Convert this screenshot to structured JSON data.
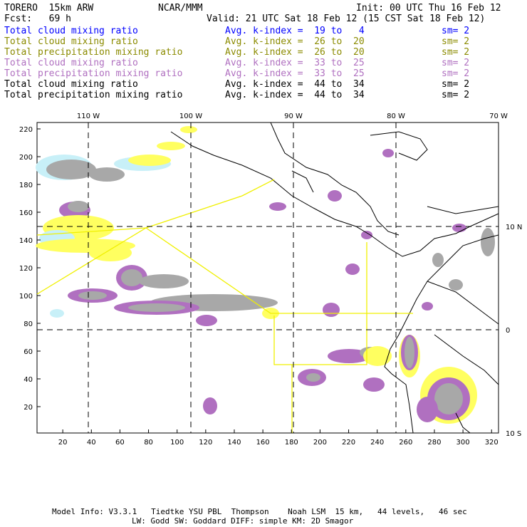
{
  "header": {
    "model": "TORERO  15km ARW",
    "org": "NCAR/MMM",
    "init": "Init: 00 UTC Thu 16 Feb 12",
    "fcst": "Fcst:   69 h",
    "valid": "Valid: 21 UTC Sat 18 Feb 12 (15 CST Sat 18 Feb 12)"
  },
  "legend": [
    {
      "field": "Total cloud mixing ratio",
      "range": "Avg. k-index =  19 to   4",
      "sm": "sm= 2",
      "color": "#0000ff"
    },
    {
      "field": "Total cloud mixing ratio",
      "range": "Avg. k-index =  26 to  20",
      "sm": "sm= 2",
      "color": "#8b8b00"
    },
    {
      "field": "Total precipitation mixing ratio",
      "range": "Avg. k-index =  26 to  20",
      "sm": "sm= 2",
      "color": "#8b8b00"
    },
    {
      "field": "Total cloud mixing ratio",
      "range": "Avg. k-index =  33 to  25",
      "sm": "sm= 2",
      "color": "#b070c0"
    },
    {
      "field": "Total precipitation mixing ratio",
      "range": "Avg. k-index =  33 to  25",
      "sm": "sm= 2",
      "color": "#b070c0"
    },
    {
      "field": "Total cloud mixing ratio",
      "range": "Avg. k-index =  44 to  34",
      "sm": "sm= 2",
      "color": "#000000"
    },
    {
      "field": "Total precipitation mixing ratio",
      "range": "Avg. k-index =  44 to  34",
      "sm": "sm= 2",
      "color": "#000000"
    }
  ],
  "map": {
    "x_ticks": [
      "20",
      "40",
      "60",
      "80",
      "100",
      "120",
      "140",
      "160",
      "180",
      "200",
      "220",
      "240",
      "260",
      "280",
      "300",
      "320"
    ],
    "y_ticks": [
      "20",
      "40",
      "60",
      "80",
      "100",
      "120",
      "140",
      "160",
      "180",
      "200",
      "220"
    ],
    "lon_labels": [
      "110 W",
      "100 W",
      "90 W",
      "80 W",
      "70 W"
    ],
    "lat_labels": [
      "10 N",
      "0",
      "10 S"
    ],
    "colors": {
      "light_cloud": "#c8f0f8",
      "yellow": "#ffff60",
      "purple": "#b070c0",
      "gray": "#a8a8a8",
      "dark": "#505050",
      "domain_lines": "#f0f000"
    }
  },
  "footer": {
    "line1": "Model Info: V3.3.1   Tiedtke YSU PBL  Thompson    Noah LSM  15 km,   44 levels,   46 sec",
    "line2": "LW: Godd SW: Goddard DIFF: simple KM: 2D Smagor"
  }
}
